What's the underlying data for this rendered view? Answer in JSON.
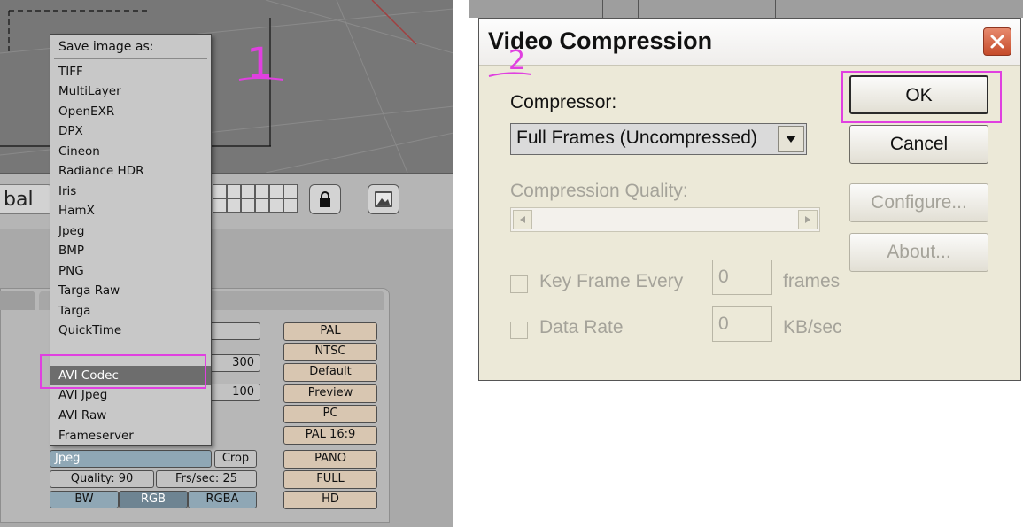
{
  "blender": {
    "pal_label": "bal",
    "save_menu": {
      "title": "Save image as:",
      "items": [
        "TIFF",
        "MultiLayer",
        "OpenEXR",
        "DPX",
        "Cineon",
        "Radiance HDR",
        "Iris",
        "HamX",
        "Jpeg",
        "BMP",
        "PNG",
        "Targa Raw",
        "Targa",
        "QuickTime",
        "AVI Codec",
        "AVI Jpeg",
        "AVI Raw",
        "Frameserver"
      ],
      "highlighted": "AVI Codec"
    },
    "presets": [
      "PAL",
      "NTSC",
      "Default",
      "Preview",
      "PC",
      "PAL 16:9",
      "PANO",
      "FULL",
      "HD"
    ],
    "field_300": "300",
    "field_100": "100",
    "format_select": "Jpeg",
    "crop_label": "Crop",
    "quality_label": "Quality: 90",
    "fps_label": "Frs/sec: 25",
    "color_modes": [
      "BW",
      "RGB",
      "RGBA"
    ],
    "color_mode_selected": "RGB"
  },
  "dialog": {
    "title": "Video Compression",
    "compressor_label": "Compressor:",
    "compressor_value": "Full Frames (Uncompressed)",
    "quality_label": "Compression Quality:",
    "keyframe_label": "Key Frame Every",
    "keyframe_value": "0",
    "keyframe_unit": "frames",
    "datarate_label": "Data Rate",
    "datarate_value": "0",
    "datarate_unit": "KB/sec",
    "ok_label": "OK",
    "cancel_label": "Cancel",
    "configure_label": "Configure...",
    "about_label": "About..."
  },
  "annotations": {
    "step1": "1",
    "step2": "2",
    "color": "#e040e0"
  }
}
